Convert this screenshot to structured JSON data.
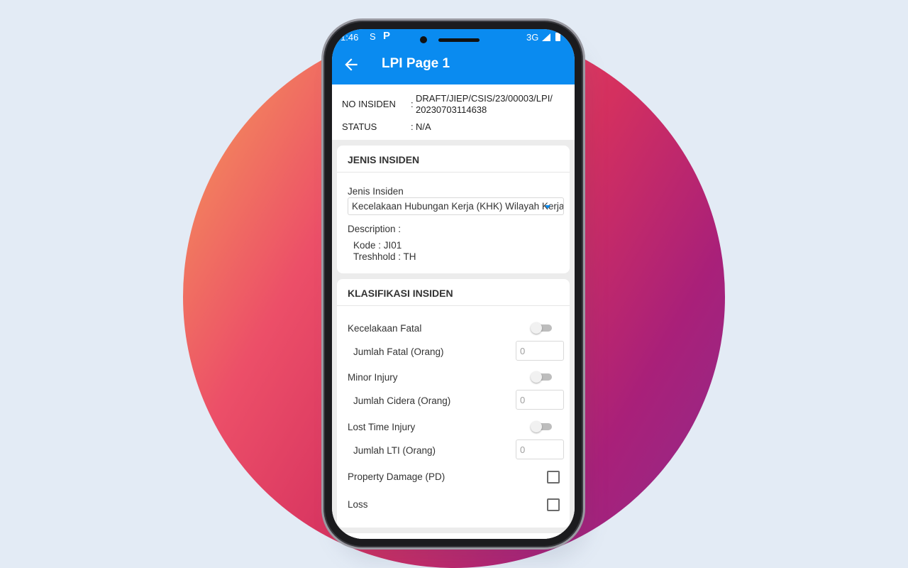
{
  "status_bar": {
    "time": "1:46",
    "icon1": "S",
    "icon2": "P",
    "network": "3G"
  },
  "app_bar": {
    "title": "LPI Page 1",
    "back_icon": "arrow-left-icon"
  },
  "info": {
    "no_insiden_label": "NO INSIDEN",
    "colon": ":",
    "no_insiden_value": "DRAFT/JIEP/CSIS/23/00003/LPI/ 20230703114638",
    "status_label": "STATUS",
    "status_value": "N/A"
  },
  "jenis_insiden_card": {
    "header": "JENIS INSIDEN",
    "field_label": "Jenis Insiden",
    "selected_value": "Kecelakaan Hubungan Kerja (KHK) Wilayah Kerja",
    "description_label": "Description :",
    "kode": "Kode : JI01",
    "treshhold": "Treshhold : TH"
  },
  "klasifikasi_card": {
    "header": "KLASIFIKASI INSIDEN",
    "kecelakaan_fatal_label": "Kecelakaan Fatal",
    "jumlah_fatal_label": "Jumlah Fatal (Orang)",
    "jumlah_fatal_placeholder": "0",
    "minor_injury_label": "Minor Injury",
    "jumlah_cidera_label": "Jumlah Cidera (Orang)",
    "jumlah_cidera_placeholder": "0",
    "lost_time_injury_label": "Lost Time Injury",
    "jumlah_lti_label": "Jumlah LTI (Orang)",
    "jumlah_lti_placeholder": "0",
    "property_damage_label": "Property Damage (PD)",
    "loss_label": "Loss"
  },
  "colors": {
    "accent": "#0a8bf0",
    "toggle_off": "#bdbdbd"
  }
}
